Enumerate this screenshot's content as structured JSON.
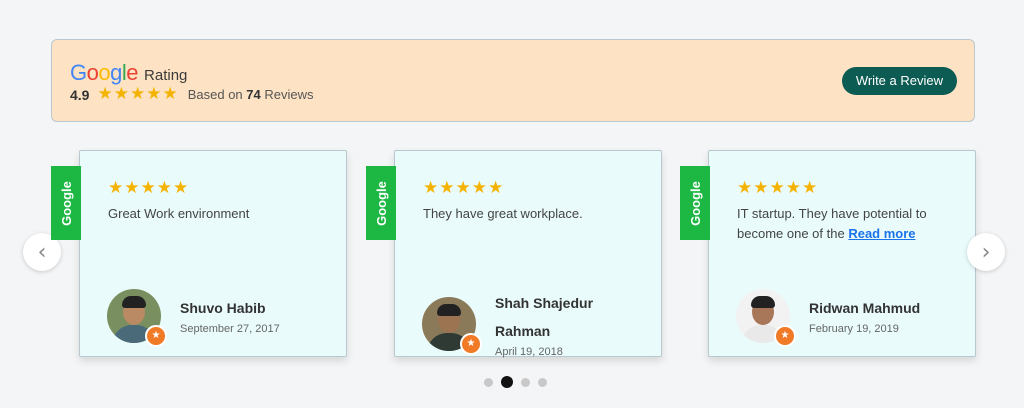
{
  "header": {
    "logo_letters": [
      "G",
      "o",
      "o",
      "g",
      "l",
      "e"
    ],
    "logo_colors": [
      "#4285f4",
      "#ea4335",
      "#fbbc05",
      "#4285f4",
      "#34a853",
      "#ea4335"
    ],
    "rating_label": "Rating",
    "score": "4.9",
    "stars": 5,
    "based_prefix": "Based on",
    "review_count": "74",
    "based_suffix": "Reviews",
    "write_review_label": "Write a Review"
  },
  "reviews": [
    {
      "source_badge": "Google",
      "stars": 5,
      "text": "Great Work environment",
      "name": "Shuvo Habib",
      "date": "September 27, 2017"
    },
    {
      "source_badge": "Google",
      "stars": 5,
      "text": "They have great workplace.",
      "name_line1": "Shah Shajedur",
      "name_line2": "Rahman",
      "date": "April 19, 2018"
    },
    {
      "source_badge": "Google",
      "stars": 5,
      "text_line1": "IT startup. They have potential to",
      "text_line2": "become one of the",
      "read_more": "Read more",
      "name": "Ridwan Mahmud",
      "date": "February 19, 2019"
    }
  ],
  "carousel": {
    "prev_icon": "chevron-left-icon",
    "next_icon": "chevron-right-icon",
    "dots": 4,
    "active_dot": 1
  },
  "colors": {
    "banner_bg": "#fde3c4",
    "button_bg": "#0c5c53",
    "badge_green": "#1db743",
    "card_bg": "#e9fbfb",
    "star": "#f5b301",
    "link": "#1a73e8"
  }
}
